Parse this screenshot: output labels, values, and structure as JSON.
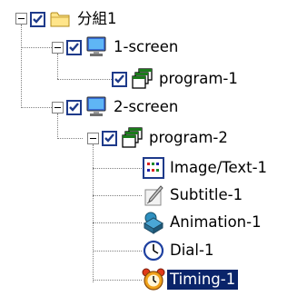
{
  "tree": {
    "nodes": [
      {
        "id": "group",
        "label": "分組1",
        "icon": "folder-icon",
        "checked": true,
        "expanded": true
      },
      {
        "id": "screen1",
        "label": "1-screen",
        "icon": "monitor-icon",
        "checked": true,
        "expanded": true
      },
      {
        "id": "program1",
        "label": "program-1",
        "icon": "program-window-icon",
        "checked": true
      },
      {
        "id": "screen2",
        "label": "2-screen",
        "icon": "monitor-icon",
        "checked": true,
        "expanded": true
      },
      {
        "id": "program2",
        "label": "program-2",
        "icon": "program-window-icon",
        "checked": true,
        "expanded": true
      },
      {
        "id": "imagetext",
        "label": "Image/Text-1",
        "icon": "image-text-icon"
      },
      {
        "id": "subtitle",
        "label": "Subtitle-1",
        "icon": "subtitle-pen-icon"
      },
      {
        "id": "animation",
        "label": "Animation-1",
        "icon": "animation-icon"
      },
      {
        "id": "dial",
        "label": "Dial-1",
        "icon": "clock-dial-icon"
      },
      {
        "id": "timing",
        "label": "Timing-1",
        "icon": "alarm-clock-icon",
        "selected": true
      }
    ]
  },
  "colors": {
    "selection": "#0a246a",
    "check": "#1e3a8a"
  }
}
